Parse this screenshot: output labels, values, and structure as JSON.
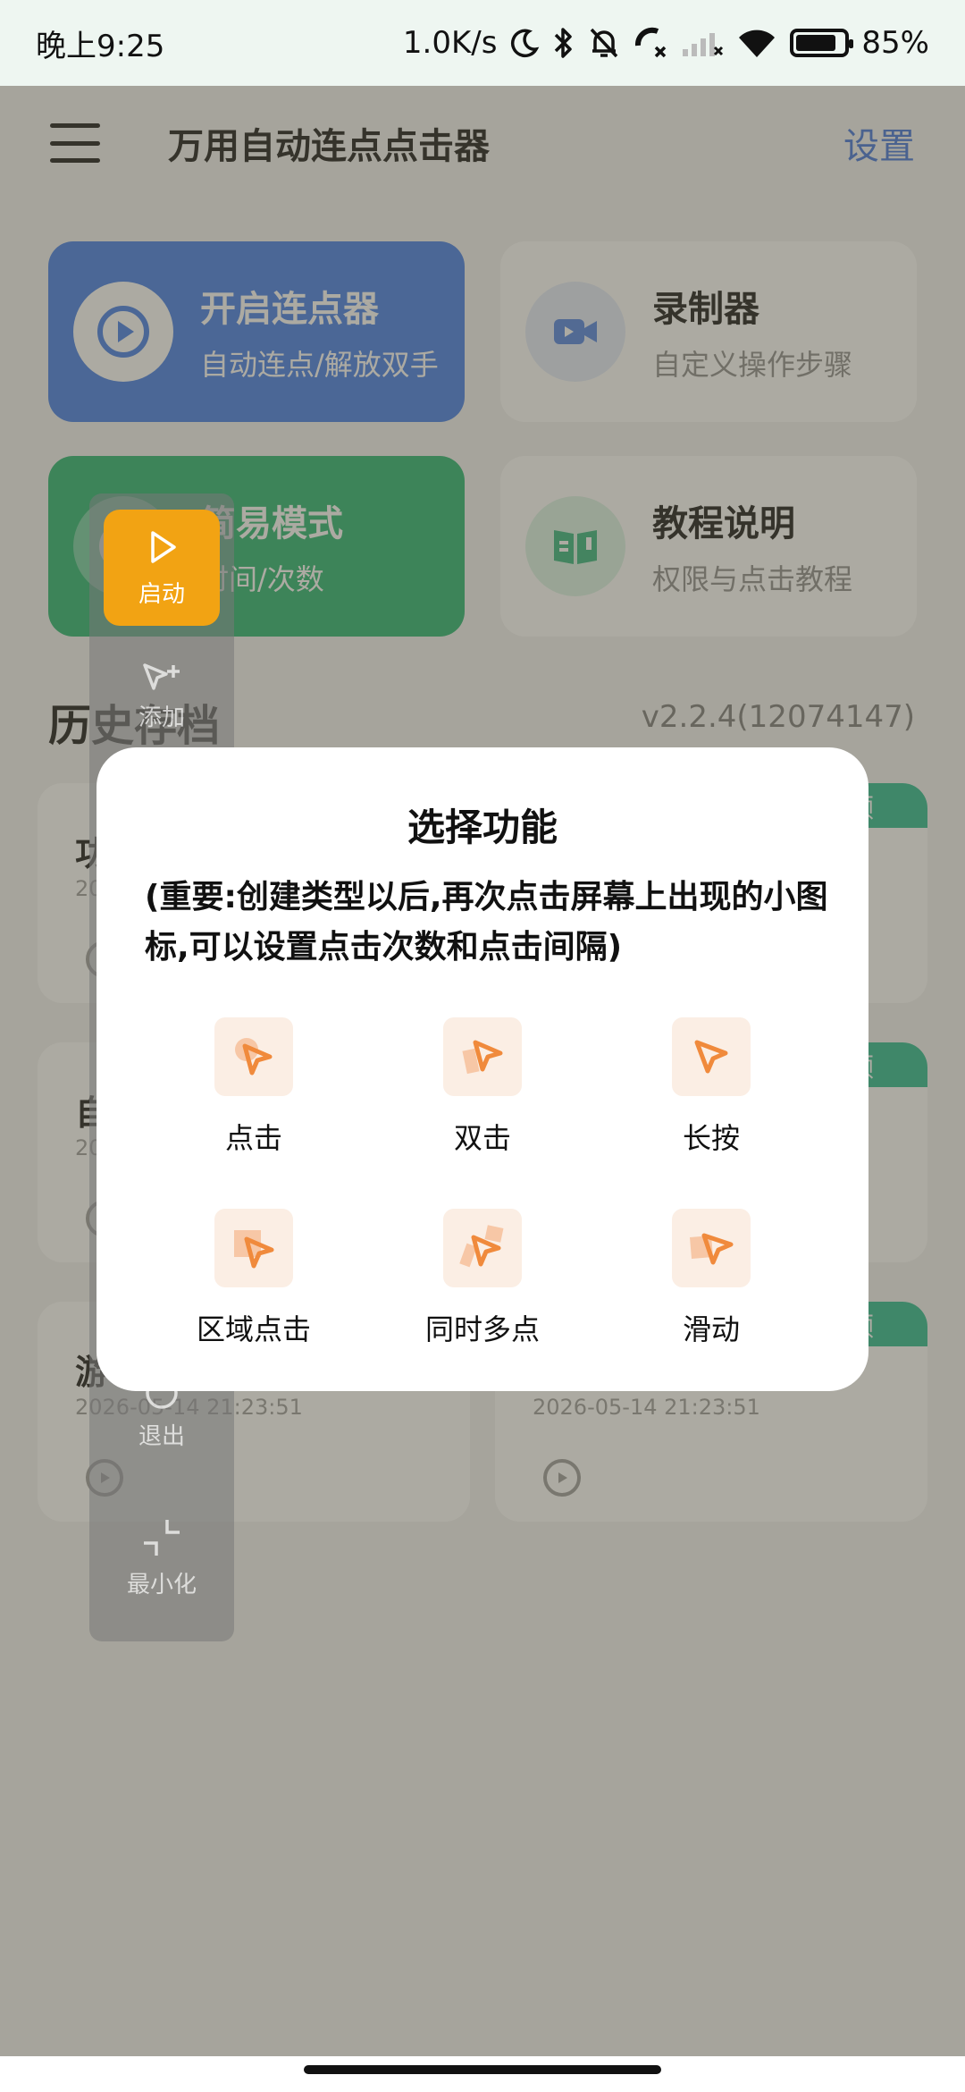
{
  "status": {
    "time": "晚上9:25",
    "speed": "1.0K/s",
    "battery": "85%"
  },
  "header": {
    "title": "万用自动连点点击器",
    "settings": "设置"
  },
  "cards": {
    "start": {
      "title": "开启连点器",
      "subtitle": "自动连点/解放双手"
    },
    "recorder": {
      "title": "录制器",
      "subtitle": "自定义操作步骤"
    },
    "easy": {
      "title": "简易模式",
      "subtitle": "时间/次数"
    },
    "tutorial": {
      "title": "教程说明",
      "subtitle": "权限与点击教程"
    }
  },
  "history": {
    "title": "历史存档",
    "version": "v2.2.4(12074147)",
    "items": [
      {
        "name": "功",
        "date": "20",
        "badge": "频"
      },
      {
        "name": "",
        "date": "",
        "badge": "频"
      },
      {
        "name": "自",
        "date": "20",
        "badge": "频"
      },
      {
        "name": "",
        "date": "",
        "badge": "频"
      },
      {
        "name": "游",
        "date": "2026-05-14 21:23:51",
        "badge": ""
      },
      {
        "name": "",
        "date": "2026-05-14 21:23:51",
        "badge": "频"
      }
    ]
  },
  "floatbar": {
    "start": "启动",
    "add": "添加",
    "exit": "退出",
    "minimize": "最小化"
  },
  "dialog": {
    "title": "选择功能",
    "note": "(重要:创建类型以后,再次点击屏幕上出现的小图标,可以设置点击次数和点击间隔)",
    "functions": [
      {
        "label": "点击",
        "icon": "tap-icon"
      },
      {
        "label": "双击",
        "icon": "double-tap-icon"
      },
      {
        "label": "长按",
        "icon": "long-press-icon"
      },
      {
        "label": "区域点击",
        "icon": "area-tap-icon"
      },
      {
        "label": "同时多点",
        "icon": "multi-tap-icon"
      },
      {
        "label": "滑动",
        "icon": "swipe-icon"
      }
    ]
  },
  "colors": {
    "accent_blue": "#3d79e6",
    "accent_green": "#21b36d",
    "float_start": "#f2a313",
    "badge_teal": "#25b88c",
    "icon_orange": "#f08a3c"
  }
}
